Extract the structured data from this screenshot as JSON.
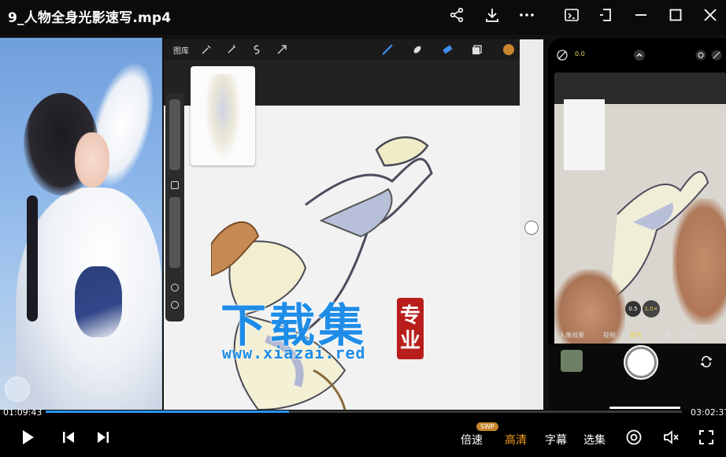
{
  "title": "9_人物全身光影速写.mp4",
  "titlebar_icons": [
    "share-icon",
    "download-icon",
    "more-icon",
    "screen-capture-icon",
    "pip-icon",
    "minimize-icon",
    "maximize-icon",
    "close-icon"
  ],
  "procreate": {
    "gallery_label": "图库"
  },
  "watermark": {
    "text": "下载集",
    "url": "www.xiazai.red",
    "seal_line1": "专",
    "seal_line2": "业"
  },
  "phone": {
    "exposure_value": "0.0",
    "zoom_05": "0.5",
    "zoom_1x": "1.0×",
    "modes": [
      "人像效果",
      "视频",
      "照片",
      "人像",
      "全景"
    ]
  },
  "playback": {
    "current_time": "01:09:43",
    "total_time": "03:02:37",
    "progress_fraction": 0.383
  },
  "controls": {
    "speed_label": "倍速",
    "swp_badge": "SWP",
    "quality_label": "高清",
    "subtitle_label": "字幕",
    "episodes_label": "选集"
  },
  "colors": {
    "accent": "#f4a21b",
    "progress": "#2c93ef",
    "watermark": "#1f8de8",
    "seal": "#b81f1c"
  }
}
